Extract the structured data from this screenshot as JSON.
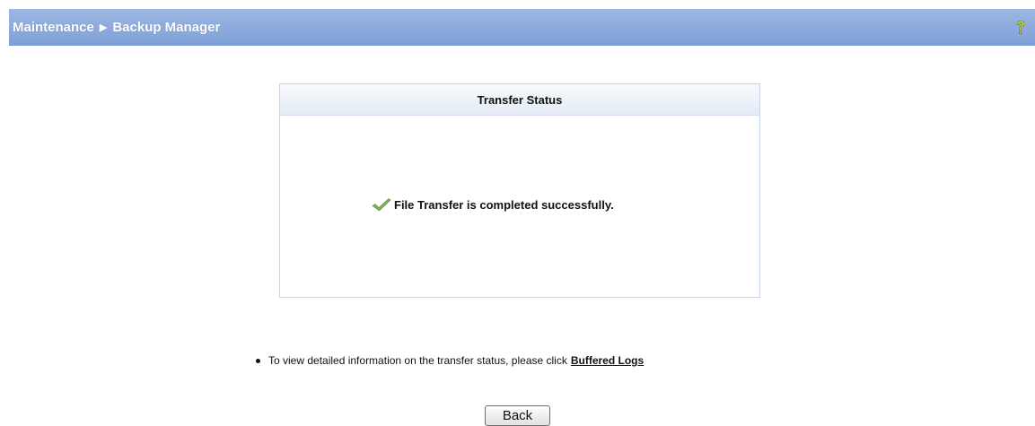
{
  "header": {
    "breadcrumb": [
      "Maintenance",
      "Backup Manager"
    ],
    "separator": "▶",
    "help_icon": "help-question-icon",
    "bar_color": "#8eabdc"
  },
  "transfer_panel": {
    "title": "Transfer Status",
    "status_icon": "checkmark-icon",
    "status_message": "File Transfer is completed successfully."
  },
  "info": {
    "text": "To view detailed information on the transfer status, please click",
    "link_label": "Buffered Logs"
  },
  "actions": {
    "back_label": "Back"
  }
}
